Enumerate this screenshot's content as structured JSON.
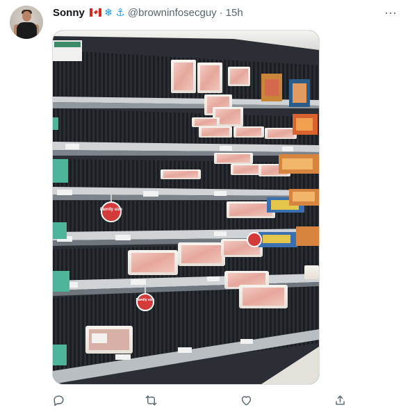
{
  "user": {
    "name": "Sonny",
    "badges": [
      "canada-flag-icon",
      "snowflake-icon",
      "anchor-icon"
    ],
    "handle": "@browninfosecguy",
    "separator": "·",
    "timestamp": "15h"
  },
  "menu": {
    "more_label": "···"
  },
  "media": {
    "alt": "Grocery store meat section with mostly empty shelves",
    "sign_labels": [
      "Family size",
      "Family size",
      "Family size"
    ]
  },
  "actions": [
    {
      "name": "reply",
      "icon": "comment-icon"
    },
    {
      "name": "retweet",
      "icon": "retweet-icon"
    },
    {
      "name": "like",
      "icon": "heart-icon"
    },
    {
      "name": "share",
      "icon": "share-icon"
    }
  ],
  "colors": {
    "secondary_text": "#536471",
    "accent": "#1d9bf0",
    "sign_red": "#d53a3a"
  }
}
